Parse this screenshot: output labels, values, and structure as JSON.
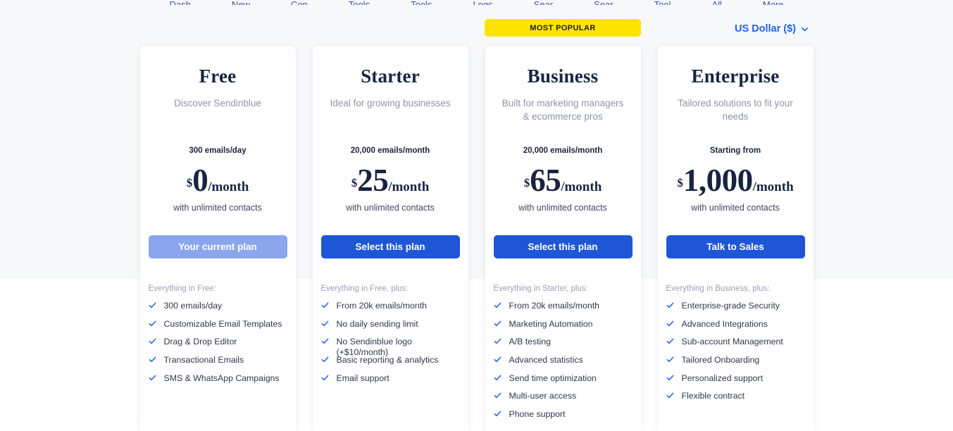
{
  "topnav": {
    "items": [
      "Dash",
      "New",
      "Con",
      "Tools",
      "Tools",
      "Logs",
      "Sear",
      "Sear",
      "Tool",
      "All",
      "More"
    ]
  },
  "badge": {
    "label": "MOST POPULAR"
  },
  "currency": {
    "label": "US Dollar ($)",
    "icon": "chevron-down-icon"
  },
  "plans": [
    {
      "name": "Free",
      "description": "Discover Sendinblue",
      "quota": "300 emails/day",
      "currency_symbol": "$",
      "amount": "0",
      "period": "/month",
      "contacts": "with unlimited contacts",
      "cta_label": "Your current plan",
      "cta_state": "current",
      "features_heading": "Everything in Free:",
      "features": [
        "300 emails/day",
        "Customizable Email Templates",
        "Drag & Drop Editor",
        "Transactional Emails",
        "SMS & WhatsApp Campaigns"
      ]
    },
    {
      "name": "Starter",
      "description": "Ideal for growing businesses",
      "quota": "20,000 emails/month",
      "currency_symbol": "$",
      "amount": "25",
      "period": "/month",
      "contacts": "with unlimited contacts",
      "cta_label": "Select this plan",
      "cta_state": "selectable",
      "features_heading": "Everything in Free, plus:",
      "features": [
        "From 20k emails/month",
        "No daily sending limit",
        "No Sendinblue logo (+$10/month)",
        "Basic reporting & analytics",
        "Email support"
      ]
    },
    {
      "name": "Business",
      "description": "Built for marketing managers & ecommerce pros",
      "quota": "20,000 emails/month",
      "currency_symbol": "$",
      "amount": "65",
      "period": "/month",
      "contacts": "with unlimited contacts",
      "cta_label": "Select this plan",
      "cta_state": "selectable",
      "features_heading": "Everything in Starter, plus:",
      "features": [
        "From 20k emails/month",
        "Marketing Automation",
        "A/B testing",
        "Advanced statistics",
        "Send time optimization",
        "Multi-user access",
        "Phone support"
      ]
    },
    {
      "name": "Enterprise",
      "description": "Tailored solutions to fit your needs",
      "quota": "Starting from",
      "currency_symbol": "$",
      "amount": "1,000",
      "period": "/month",
      "contacts": "with unlimited contacts",
      "cta_label": "Talk to Sales",
      "cta_state": "selectable",
      "features_heading": "Everything in Business, plus:",
      "features": [
        "Enterprise-grade Security",
        "Advanced Integrations",
        "Sub-account Management",
        "Tailored Onboarding",
        "Personalized support",
        "Flexible contract"
      ]
    }
  ],
  "colors": {
    "accent_blue": "#1f56d6",
    "muted_blue": "#8ba6ec",
    "badge_yellow": "#ffe300",
    "heading_navy": "#18243f",
    "page_grey": "#f7f8fa"
  }
}
